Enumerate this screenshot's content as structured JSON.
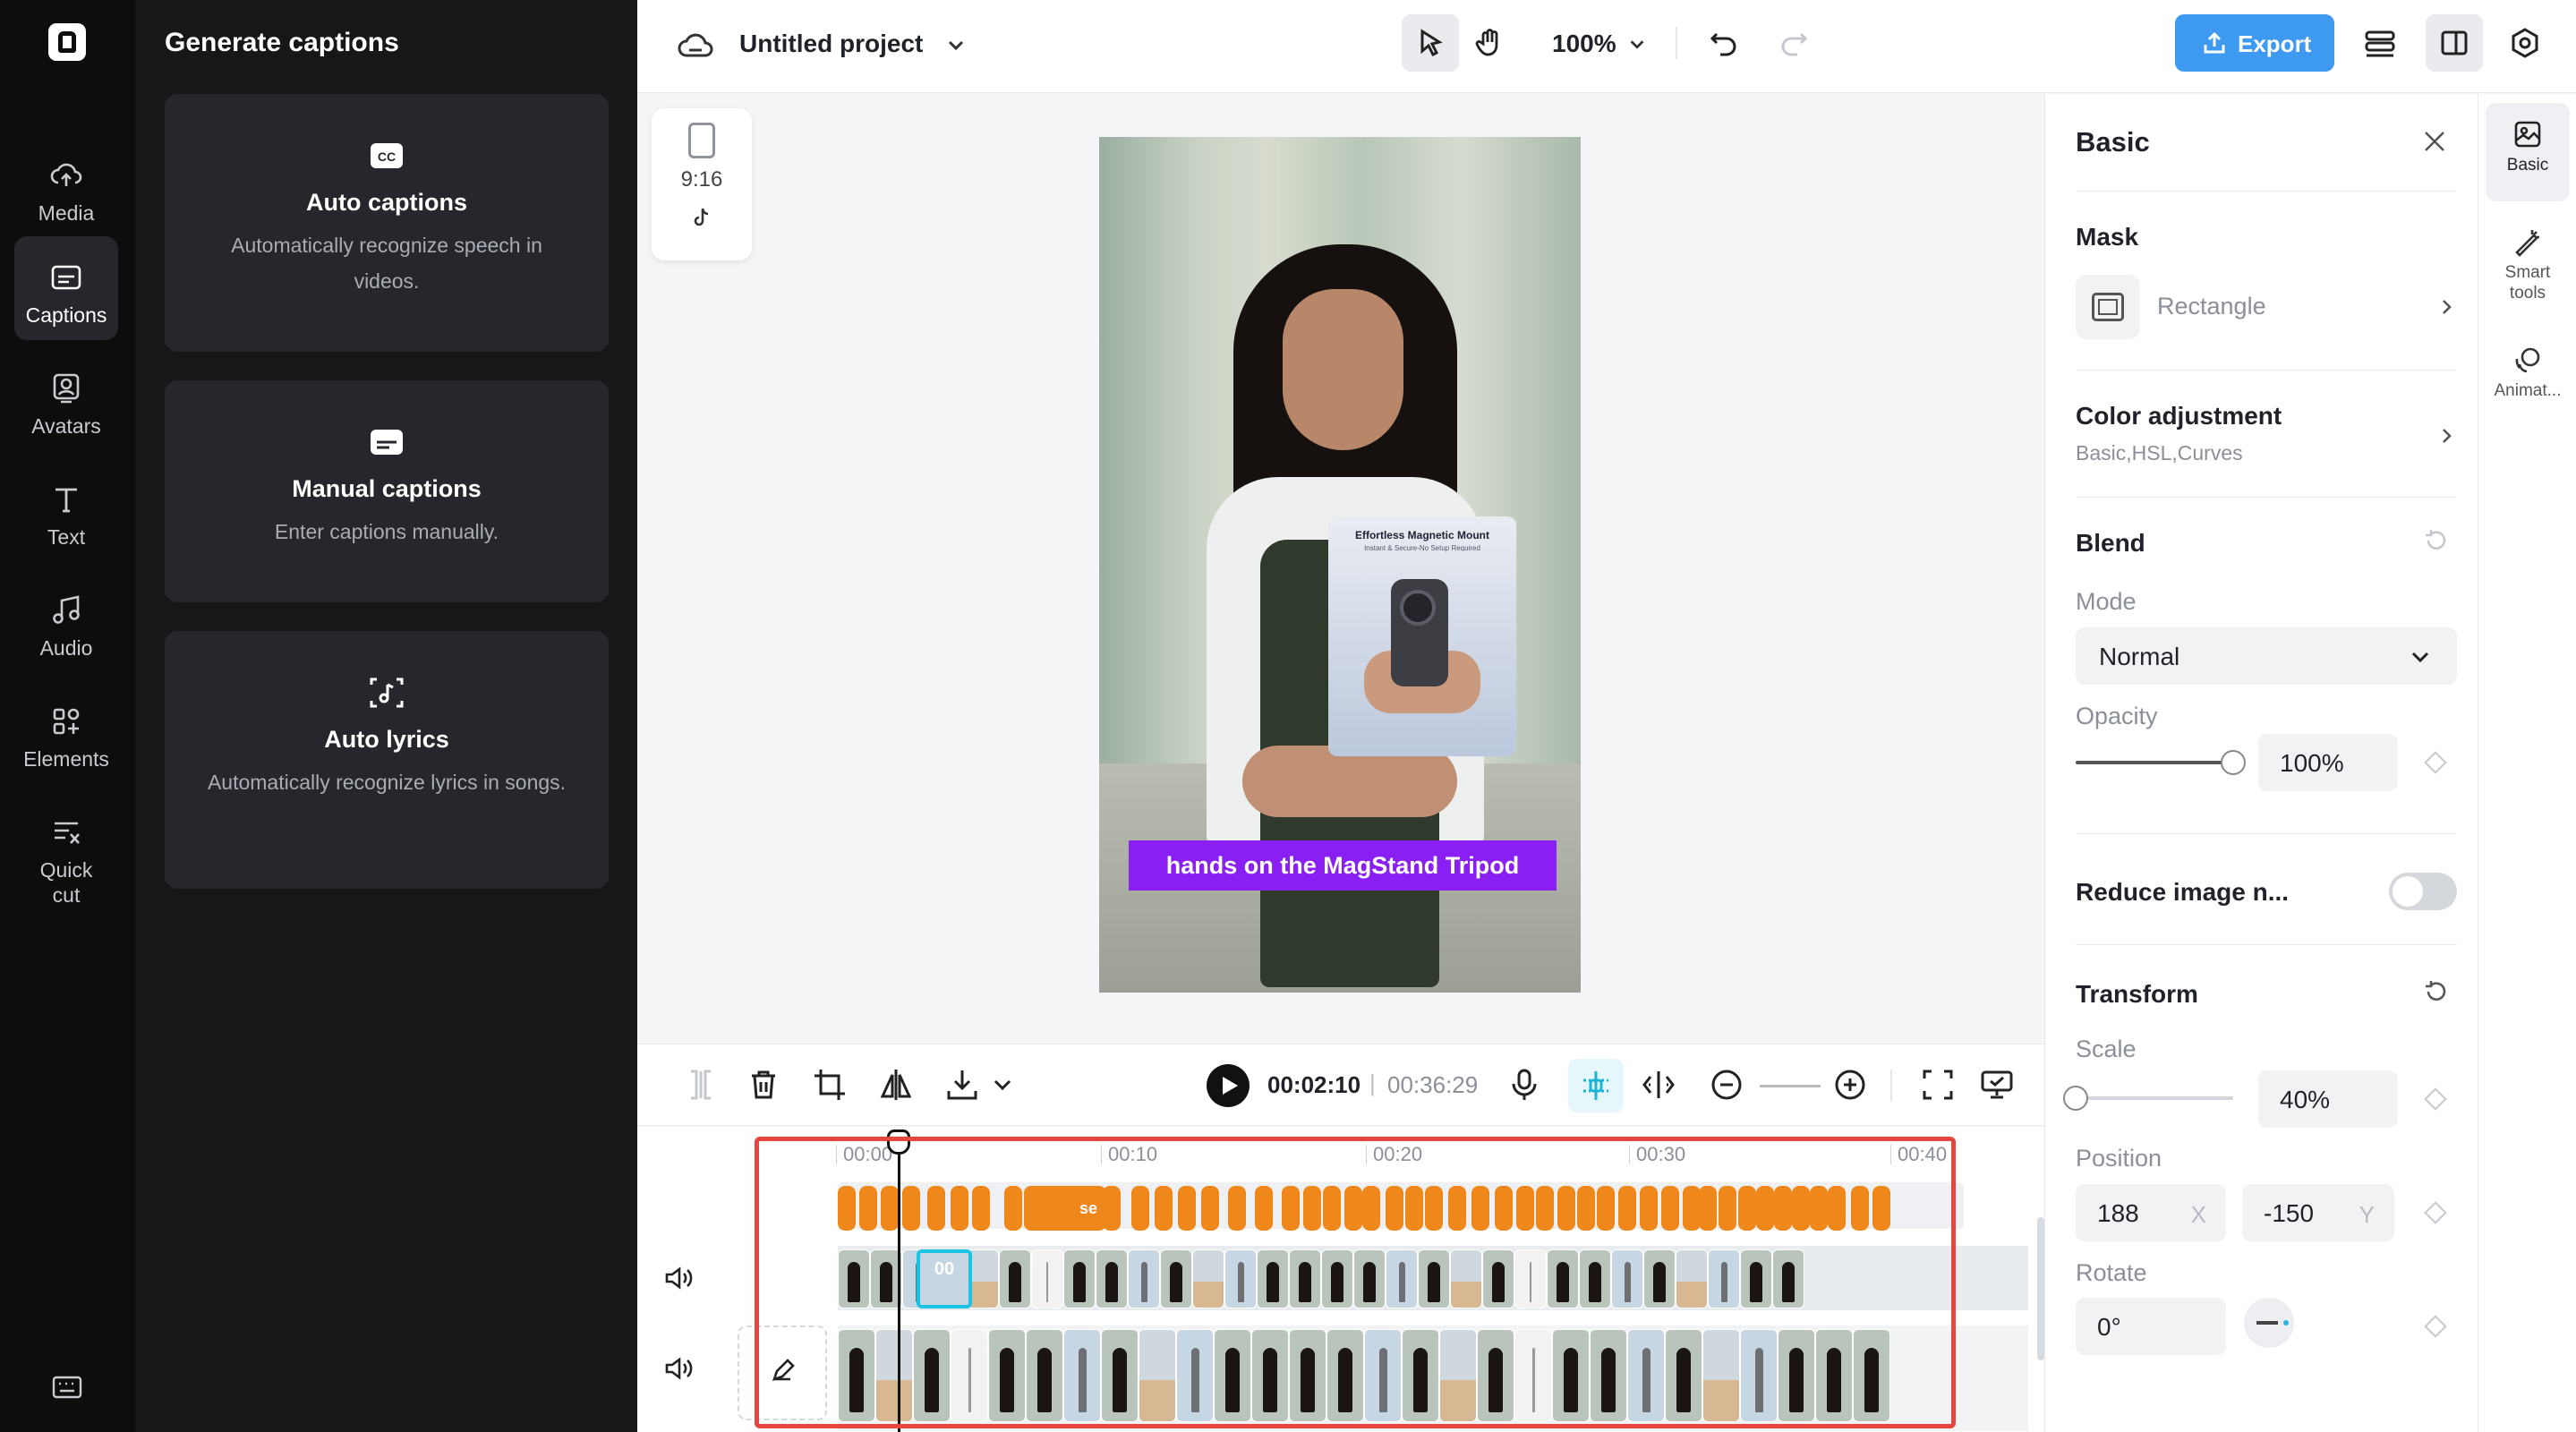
{
  "rail": {
    "items": [
      {
        "label": "Media",
        "icon": "cloud-upload-icon"
      },
      {
        "label": "Captions",
        "icon": "captions-icon",
        "active": true
      },
      {
        "label": "Avatars",
        "icon": "avatar-icon"
      },
      {
        "label": "Text",
        "icon": "text-icon"
      },
      {
        "label": "Audio",
        "icon": "music-note-icon"
      },
      {
        "label": "Elements",
        "icon": "elements-icon"
      },
      {
        "label": "Quick cut",
        "icon": "quick-cut-icon"
      }
    ]
  },
  "panel": {
    "title": "Generate captions",
    "options": [
      {
        "title": "Auto captions",
        "desc": "Automatically recognize speech in videos.",
        "icon": "cc-icon"
      },
      {
        "title": "Manual captions",
        "desc": "Enter captions manually.",
        "icon": "subtitle-icon"
      },
      {
        "title": "Auto lyrics",
        "desc": "Automatically recognize lyrics in songs.",
        "icon": "lyrics-scan-icon"
      }
    ]
  },
  "topbar": {
    "project_title": "Untitled project",
    "zoom": "100%",
    "export_label": "Export",
    "accent": "#3e99f0"
  },
  "canvas": {
    "ratio_label": "9:16",
    "caption_text": "hands on the MagStand Tripod",
    "caption_color": "#8a1ff3",
    "overlay_title": "Effortless Magnetic Mount",
    "overlay_subtitle": "Instant & Secure-No Setup Required"
  },
  "playback": {
    "current_time": "00:02:10",
    "separator": "|",
    "total_time": "00:36:29"
  },
  "timeline": {
    "ruler": [
      "00:00",
      "00:10",
      "00:20",
      "00:30",
      "00:40"
    ],
    "caption_clip_labels": [
      "se"
    ],
    "main_clip_label": "00",
    "highlight_color": "#e6463e",
    "caption_clip_color": "#f0871a"
  },
  "props": {
    "title": "Basic",
    "mask": {
      "section": "Mask",
      "value": "Rectangle"
    },
    "color_adjustment": {
      "section": "Color adjustment",
      "sub": "Basic,HSL,Curves"
    },
    "blend": {
      "section": "Blend",
      "mode_label": "Mode",
      "mode_value": "Normal",
      "opacity_label": "Opacity",
      "opacity_value": "100%",
      "opacity_level": 1.0
    },
    "reduce_noise": {
      "label": "Reduce image n...",
      "enabled": false
    },
    "transform": {
      "section": "Transform",
      "scale_label": "Scale",
      "scale_value": "40%",
      "scale_level": 0.0,
      "position_label": "Position",
      "pos_x": "188",
      "pos_x_axis": "X",
      "pos_y": "-150",
      "pos_y_axis": "Y",
      "rotate_label": "Rotate",
      "rotate_value": "0°"
    }
  },
  "right_tabs": [
    {
      "label": "Basic",
      "icon": "image-adjust-icon",
      "active": true
    },
    {
      "label": "Smart tools",
      "icon": "magic-wand-icon"
    },
    {
      "label": "Animat...",
      "icon": "animation-icon"
    }
  ]
}
